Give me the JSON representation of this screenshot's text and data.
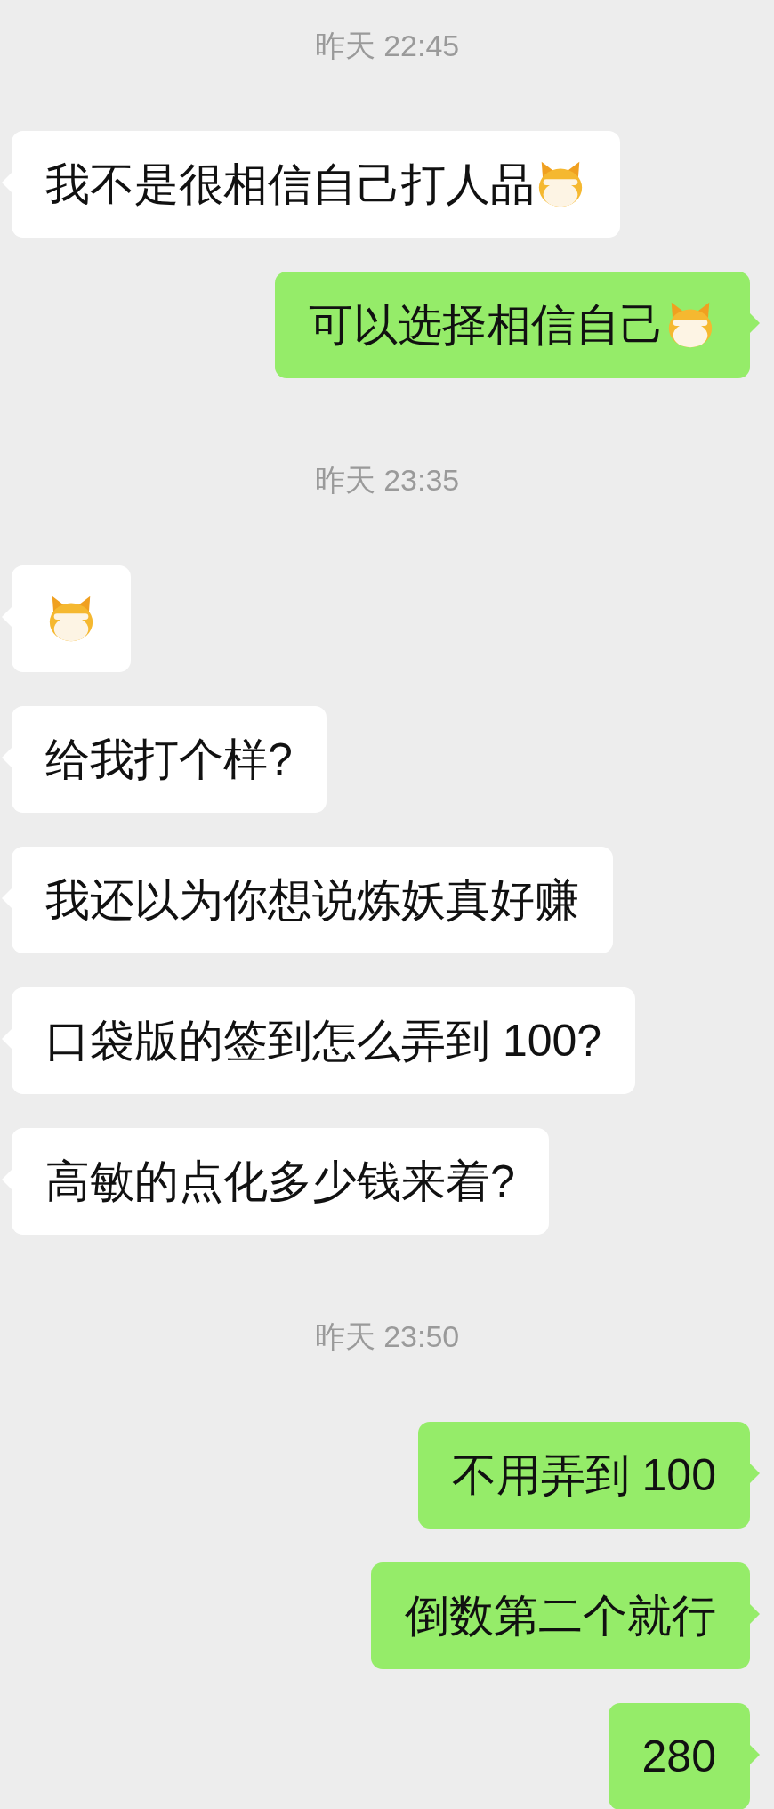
{
  "messages": [
    {
      "kind": "time",
      "text": "昨天 22:45"
    },
    {
      "kind": "received",
      "text": "我不是很相信自己打人品",
      "emoji": true
    },
    {
      "kind": "sent",
      "text": "可以选择相信自己",
      "emoji": true
    },
    {
      "kind": "time",
      "text": "昨天 23:35"
    },
    {
      "kind": "received",
      "emoji": true
    },
    {
      "kind": "received",
      "text": "给我打个样?",
      "emoji": false
    },
    {
      "kind": "received",
      "text": "我还以为你想说炼妖真好赚",
      "emoji": false
    },
    {
      "kind": "received",
      "text": "口袋版的签到怎么弄到 100?",
      "emoji": false
    },
    {
      "kind": "received",
      "text": "高敏的点化多少钱来着?",
      "emoji": false
    },
    {
      "kind": "time",
      "text": "昨天 23:50"
    },
    {
      "kind": "sent",
      "text": "不用弄到 100",
      "emoji": false
    },
    {
      "kind": "sent",
      "text": "倒数第二个就行",
      "emoji": false
    },
    {
      "kind": "sent",
      "text": "280",
      "emoji": false
    }
  ]
}
